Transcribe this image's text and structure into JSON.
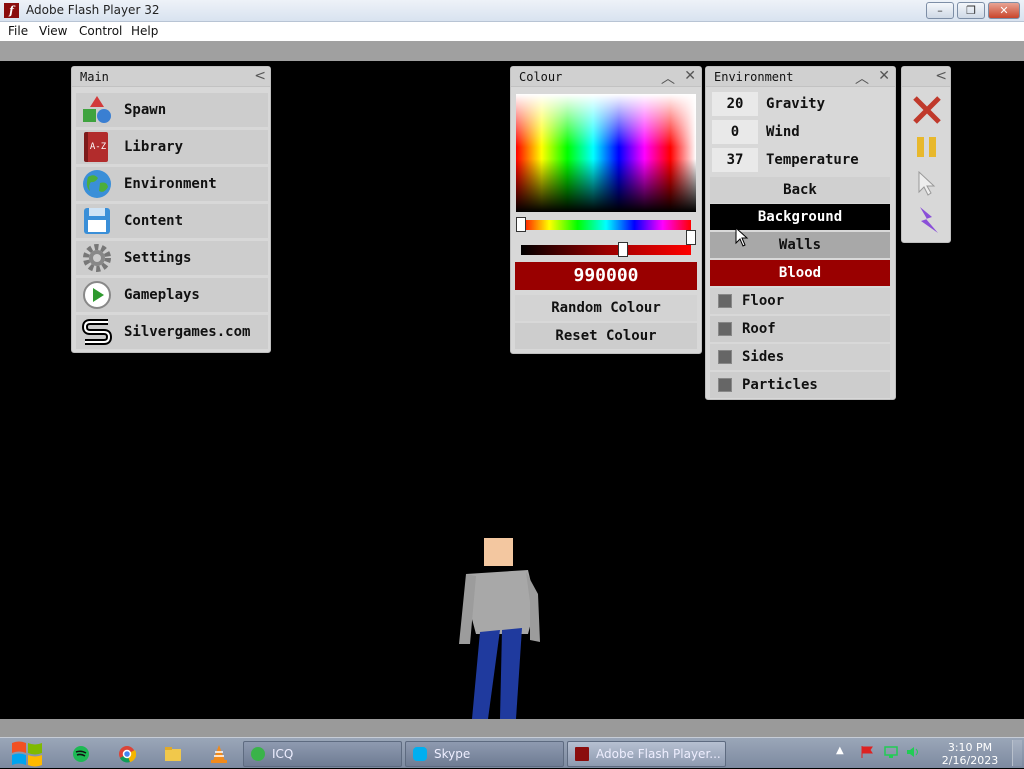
{
  "window": {
    "title": "Adobe Flash Player 32",
    "minimize": "–",
    "restore": "❐",
    "close": "✕"
  },
  "menu": [
    "File",
    "View",
    "Control",
    "Help"
  ],
  "main_panel": {
    "title": "Main",
    "collapse": "<",
    "items": [
      {
        "label": "Spawn",
        "icon": "shapes-icon"
      },
      {
        "label": "Library",
        "icon": "book-az-icon"
      },
      {
        "label": "Environment",
        "icon": "globe-icon"
      },
      {
        "label": "Content",
        "icon": "floppy-disk-icon"
      },
      {
        "label": "Settings",
        "icon": "gear-icon"
      },
      {
        "label": "Gameplays",
        "icon": "play-icon"
      },
      {
        "label": "Silvergames.com",
        "icon": "silvergames-logo-icon"
      }
    ],
    "book_text": "A-Z"
  },
  "colour_panel": {
    "title": "Colour",
    "hex_value": "990000",
    "random": "Random Colour",
    "reset": "Reset Colour",
    "selected_color": "#990000"
  },
  "env_panel": {
    "title": "Environment",
    "gravity": {
      "value": "20",
      "label": "Gravity"
    },
    "wind": {
      "value": "0",
      "label": "Wind"
    },
    "temperature": {
      "value": "37",
      "label": "Temperature"
    },
    "back": "Back",
    "background": "Background",
    "walls": "Walls",
    "blood": "Blood",
    "checks": [
      "Floor",
      "Roof",
      "Sides",
      "Particles"
    ],
    "colors": {
      "background": "#000000",
      "walls": "#a8a8a8",
      "blood": "#990000"
    }
  },
  "tools_panel": {
    "collapse": "<",
    "tools": [
      "delete-tool-icon",
      "pause-icon",
      "cursor-tool-icon",
      "lightning-tool-icon"
    ]
  },
  "taskbar": {
    "tasks": [
      {
        "label": "ICQ",
        "icon": "icq-icon"
      },
      {
        "label": "Skype",
        "icon": "skype-icon"
      },
      {
        "label": "Adobe Flash Player...",
        "icon": "flash-icon"
      }
    ],
    "time": "3:10 PM",
    "date": "2/16/2023"
  }
}
